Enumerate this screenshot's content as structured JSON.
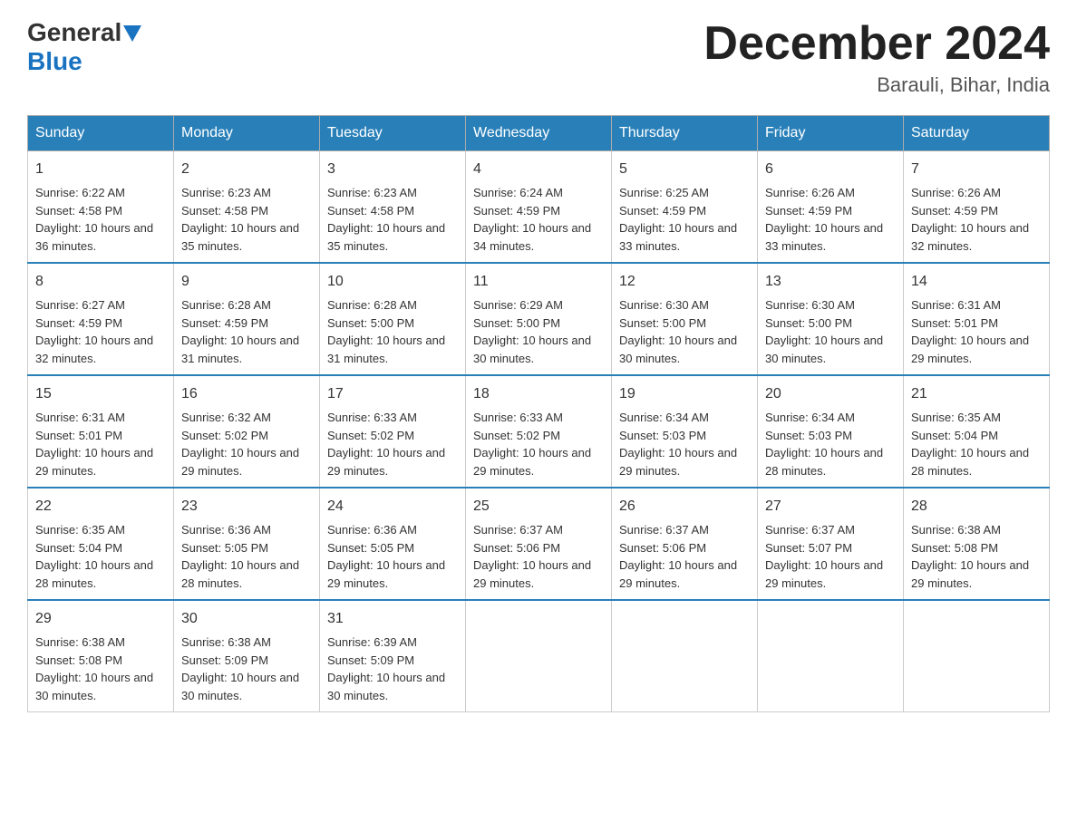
{
  "header": {
    "logo_general": "General",
    "logo_blue": "Blue",
    "month_title": "December 2024",
    "location": "Barauli, Bihar, India"
  },
  "days_of_week": [
    "Sunday",
    "Monday",
    "Tuesday",
    "Wednesday",
    "Thursday",
    "Friday",
    "Saturday"
  ],
  "weeks": [
    [
      {
        "day": 1,
        "sunrise": "6:22 AM",
        "sunset": "4:58 PM",
        "daylight": "10 hours and 36 minutes."
      },
      {
        "day": 2,
        "sunrise": "6:23 AM",
        "sunset": "4:58 PM",
        "daylight": "10 hours and 35 minutes."
      },
      {
        "day": 3,
        "sunrise": "6:23 AM",
        "sunset": "4:58 PM",
        "daylight": "10 hours and 35 minutes."
      },
      {
        "day": 4,
        "sunrise": "6:24 AM",
        "sunset": "4:59 PM",
        "daylight": "10 hours and 34 minutes."
      },
      {
        "day": 5,
        "sunrise": "6:25 AM",
        "sunset": "4:59 PM",
        "daylight": "10 hours and 33 minutes."
      },
      {
        "day": 6,
        "sunrise": "6:26 AM",
        "sunset": "4:59 PM",
        "daylight": "10 hours and 33 minutes."
      },
      {
        "day": 7,
        "sunrise": "6:26 AM",
        "sunset": "4:59 PM",
        "daylight": "10 hours and 32 minutes."
      }
    ],
    [
      {
        "day": 8,
        "sunrise": "6:27 AM",
        "sunset": "4:59 PM",
        "daylight": "10 hours and 32 minutes."
      },
      {
        "day": 9,
        "sunrise": "6:28 AM",
        "sunset": "4:59 PM",
        "daylight": "10 hours and 31 minutes."
      },
      {
        "day": 10,
        "sunrise": "6:28 AM",
        "sunset": "5:00 PM",
        "daylight": "10 hours and 31 minutes."
      },
      {
        "day": 11,
        "sunrise": "6:29 AM",
        "sunset": "5:00 PM",
        "daylight": "10 hours and 30 minutes."
      },
      {
        "day": 12,
        "sunrise": "6:30 AM",
        "sunset": "5:00 PM",
        "daylight": "10 hours and 30 minutes."
      },
      {
        "day": 13,
        "sunrise": "6:30 AM",
        "sunset": "5:00 PM",
        "daylight": "10 hours and 30 minutes."
      },
      {
        "day": 14,
        "sunrise": "6:31 AM",
        "sunset": "5:01 PM",
        "daylight": "10 hours and 29 minutes."
      }
    ],
    [
      {
        "day": 15,
        "sunrise": "6:31 AM",
        "sunset": "5:01 PM",
        "daylight": "10 hours and 29 minutes."
      },
      {
        "day": 16,
        "sunrise": "6:32 AM",
        "sunset": "5:02 PM",
        "daylight": "10 hours and 29 minutes."
      },
      {
        "day": 17,
        "sunrise": "6:33 AM",
        "sunset": "5:02 PM",
        "daylight": "10 hours and 29 minutes."
      },
      {
        "day": 18,
        "sunrise": "6:33 AM",
        "sunset": "5:02 PM",
        "daylight": "10 hours and 29 minutes."
      },
      {
        "day": 19,
        "sunrise": "6:34 AM",
        "sunset": "5:03 PM",
        "daylight": "10 hours and 29 minutes."
      },
      {
        "day": 20,
        "sunrise": "6:34 AM",
        "sunset": "5:03 PM",
        "daylight": "10 hours and 28 minutes."
      },
      {
        "day": 21,
        "sunrise": "6:35 AM",
        "sunset": "5:04 PM",
        "daylight": "10 hours and 28 minutes."
      }
    ],
    [
      {
        "day": 22,
        "sunrise": "6:35 AM",
        "sunset": "5:04 PM",
        "daylight": "10 hours and 28 minutes."
      },
      {
        "day": 23,
        "sunrise": "6:36 AM",
        "sunset": "5:05 PM",
        "daylight": "10 hours and 28 minutes."
      },
      {
        "day": 24,
        "sunrise": "6:36 AM",
        "sunset": "5:05 PM",
        "daylight": "10 hours and 29 minutes."
      },
      {
        "day": 25,
        "sunrise": "6:37 AM",
        "sunset": "5:06 PM",
        "daylight": "10 hours and 29 minutes."
      },
      {
        "day": 26,
        "sunrise": "6:37 AM",
        "sunset": "5:06 PM",
        "daylight": "10 hours and 29 minutes."
      },
      {
        "day": 27,
        "sunrise": "6:37 AM",
        "sunset": "5:07 PM",
        "daylight": "10 hours and 29 minutes."
      },
      {
        "day": 28,
        "sunrise": "6:38 AM",
        "sunset": "5:08 PM",
        "daylight": "10 hours and 29 minutes."
      }
    ],
    [
      {
        "day": 29,
        "sunrise": "6:38 AM",
        "sunset": "5:08 PM",
        "daylight": "10 hours and 30 minutes."
      },
      {
        "day": 30,
        "sunrise": "6:38 AM",
        "sunset": "5:09 PM",
        "daylight": "10 hours and 30 minutes."
      },
      {
        "day": 31,
        "sunrise": "6:39 AM",
        "sunset": "5:09 PM",
        "daylight": "10 hours and 30 minutes."
      },
      null,
      null,
      null,
      null
    ]
  ],
  "labels": {
    "sunrise": "Sunrise:",
    "sunset": "Sunset:",
    "daylight": "Daylight:"
  }
}
